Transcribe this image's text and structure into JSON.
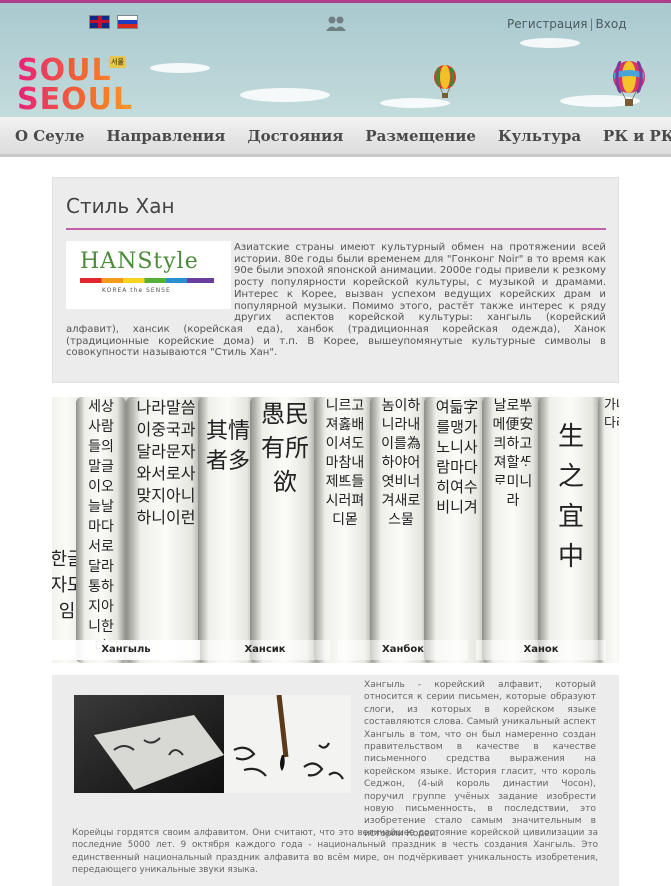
{
  "header": {
    "languages": [
      {
        "name": "english-flag-icon"
      },
      {
        "name": "russian-flag-icon"
      }
    ],
    "auth": {
      "register": "Регистрация",
      "separator": "|",
      "login": "Вход"
    },
    "logo": {
      "line1": "SOUL",
      "line2": "SEOUL",
      "badge": "서울"
    }
  },
  "nav": {
    "items": [
      "О Сеуле",
      "Направления",
      "Достояния",
      "Размещение",
      "Культура",
      "РК и РК"
    ]
  },
  "intro": {
    "title": "Стиль Хан",
    "logo_word": "HANStyle",
    "logo_tag": "KOREA the SENSE",
    "text": "Азиатские страны имеют культурный обмен на протяжении всей истории. 80е годы были временем для \"Гонконг Noir\" в то время как 90е были эпохой японской анимации. 2000е годы привели к резкому росту популярности корейской культуры, с музыкой и драмами. Интерес к Корее, вызван успехом ведущих корейских драм и популярной музыки. Помимо этого, растёт также интерес к ряду других аспектов корейской культуры: хангыль (корейский алфавит), хансик (корейская еда), ханбок (традиционная корейская одежда), Ханок (традиционные корейские дома) и т.п. В Корее, вышеупомянутые культурные символы в совокупности называются \"Стиль Хан\"."
  },
  "banner": {
    "tabs": [
      "Хангыль",
      "Хансик",
      "Ханбок",
      "Ханок"
    ],
    "active_tab": "Хангыль"
  },
  "hangul": {
    "text": "Хангыль - корейский алфавит, который относится к серии письмен, которые образуют слоги, из которых в корейском языке составляются слова. Самый уникальный аспект Хангыль в том, что он был намеренно создан правительством в качестве в качестве письменного средства выражения на корейском языке. История гласит, что король Седжон, (4-ый король династии Чосон), поручил группе учёных задание изобрести новую письменность, в последствии, это изобретение стало самым значительным в истории Кореи.",
    "footer": "Корейцы гордятся своим алфавитом. Они считают, что это величайшее достояние корейской цивилизации за последние 5000 лет. 9 октября каждого года - национальный праздник в честь создания Хангыль. Это единственный национальный праздник алфавита во всём мире, он подчёркивает уникальность изобретения, передающего уникальные звуки языка."
  }
}
